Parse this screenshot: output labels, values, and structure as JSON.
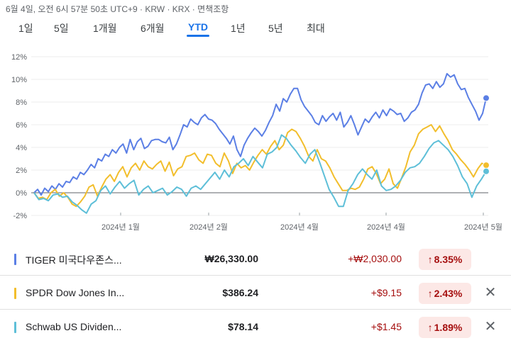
{
  "header": {
    "timestamp": "6월 4일, 오전 6시 57분 50초 UTC+9 · KRW · KRX · 면책조항"
  },
  "tabs": [
    {
      "label": "1일"
    },
    {
      "label": "5일"
    },
    {
      "label": "1개월"
    },
    {
      "label": "6개월"
    },
    {
      "label": "YTD",
      "active": true
    },
    {
      "label": "1년"
    },
    {
      "label": "5년"
    },
    {
      "label": "최대"
    }
  ],
  "colors": {
    "blue": "#5b7fe5",
    "yellow": "#f2be2c",
    "cyan": "#5ebfd8",
    "positive": "#a50e0e",
    "badge_bg": "#fce8e6"
  },
  "chart_data": {
    "type": "line",
    "y_unit": "%",
    "ylim": [
      -2,
      12
    ],
    "y_ticks": [
      "12%",
      "10%",
      "8%",
      "6%",
      "4%",
      "2%",
      "0%",
      "-2%"
    ],
    "x_ticks": [
      "2024년 1월",
      "2024년 2월",
      "2024년 4월",
      "2024년 4월",
      "2024년 5월"
    ],
    "grid": true,
    "series": [
      {
        "name": "TIGER 미국다우존스...",
        "color": "#5b7fe5",
        "values": [
          0.0,
          0.3,
          -0.2,
          0.4,
          0.1,
          0.6,
          0.3,
          0.8,
          0.5,
          1.0,
          0.9,
          1.4,
          1.2,
          1.8,
          1.6,
          2.0,
          2.5,
          2.2,
          3.0,
          2.8,
          3.4,
          3.2,
          3.8,
          3.5,
          4.0,
          4.3,
          3.5,
          4.7,
          3.8,
          4.5,
          4.8,
          3.9,
          4.1,
          4.6,
          4.7,
          4.7,
          4.5,
          4.4,
          4.9,
          3.8,
          4.3,
          5.1,
          6.0,
          5.8,
          6.5,
          6.2,
          6.0,
          6.6,
          6.9,
          6.5,
          6.4,
          6.1,
          5.6,
          5.2,
          4.8,
          4.3,
          5.0,
          3.8,
          3.2,
          4.2,
          4.8,
          5.3,
          5.7,
          5.4,
          5.0,
          5.5,
          6.2,
          6.8,
          7.8,
          7.2,
          8.3,
          8.0,
          8.7,
          9.2,
          9.2,
          8.2,
          7.6,
          7.2,
          6.8,
          6.2,
          6.0,
          6.8,
          6.3,
          6.7,
          7.0,
          6.4,
          7.1,
          5.8,
          6.2,
          6.8,
          6.0,
          5.1,
          5.8,
          6.5,
          6.2,
          6.7,
          7.1,
          6.6,
          7.3,
          6.8,
          7.4,
          7.2,
          6.9,
          7.0,
          6.3,
          6.6,
          7.1,
          7.3,
          7.8,
          8.8,
          9.5,
          9.6,
          9.2,
          9.8,
          9.3,
          9.6,
          10.5,
          10.2,
          10.4,
          9.6,
          9.1,
          9.2,
          8.4,
          7.8,
          7.2,
          6.4,
          7.0,
          8.35
        ]
      },
      {
        "name": "SPDR Dow Jones In...",
        "color": "#f2be2c",
        "values": [
          0.0,
          -0.5,
          -0.4,
          -0.6,
          0.0,
          0.3,
          -0.3,
          0.0,
          -0.4,
          -1.0,
          -1.2,
          -0.8,
          -0.3,
          0.5,
          0.7,
          -0.3,
          0.5,
          1.2,
          1.6,
          1.0,
          1.8,
          2.3,
          1.4,
          2.2,
          2.6,
          2.0,
          2.8,
          2.3,
          2.1,
          2.5,
          2.8,
          1.9,
          2.7,
          1.5,
          2.1,
          2.3,
          3.2,
          3.3,
          3.5,
          2.9,
          2.6,
          3.4,
          3.3,
          2.6,
          2.3,
          3.5,
          2.8,
          1.7,
          2.6,
          2.2,
          2.4,
          2.0,
          2.7,
          3.3,
          3.8,
          3.4,
          4.1,
          4.6,
          3.8,
          4.2,
          5.3,
          5.6,
          5.4,
          4.8,
          4.1,
          3.2,
          2.8,
          3.8,
          3.0,
          2.8,
          2.2,
          1.4,
          0.8,
          0.2,
          0.2,
          0.4,
          0.3,
          0.5,
          1.2,
          2.1,
          2.3,
          1.7,
          0.8,
          1.2,
          2.1,
          0.8,
          0.4,
          1.3,
          2.3,
          3.6,
          4.2,
          5.2,
          5.6,
          5.8,
          6.0,
          5.4,
          5.9,
          5.2,
          4.6,
          3.8,
          3.4,
          2.9,
          2.5,
          2.0,
          1.4,
          2.1,
          2.6,
          2.43
        ]
      },
      {
        "name": "Schwab US Dividen...",
        "color": "#5ebfd8",
        "values": [
          0.0,
          -0.6,
          -0.5,
          -0.7,
          -0.2,
          -0.1,
          -0.4,
          -0.3,
          -0.8,
          -1.1,
          -1.5,
          -1.8,
          -1.0,
          -0.7,
          0.2,
          0.6,
          -0.1,
          0.5,
          1.0,
          0.4,
          0.8,
          1.1,
          -0.2,
          0.3,
          0.6,
          0.0,
          0.2,
          0.4,
          -0.2,
          0.1,
          0.5,
          0.3,
          -0.3,
          0.4,
          0.6,
          0.3,
          0.8,
          1.3,
          1.8,
          1.2,
          2.0,
          1.4,
          2.3,
          2.6,
          3.0,
          2.4,
          3.2,
          2.7,
          2.2,
          3.4,
          3.6,
          4.0,
          5.1,
          4.8,
          4.2,
          3.7,
          3.1,
          2.6,
          3.4,
          3.8,
          2.7,
          1.5,
          0.3,
          -0.4,
          -1.2,
          -1.2,
          0.2,
          0.8,
          1.6,
          2.1,
          1.6,
          1.2,
          2.0,
          0.6,
          0.2,
          0.3,
          0.6,
          1.1,
          1.8,
          2.2,
          2.3,
          2.6,
          3.2,
          3.9,
          4.4,
          4.6,
          4.2,
          3.8,
          3.2,
          2.4,
          1.4,
          0.8,
          -0.4,
          0.6,
          1.2,
          1.89
        ]
      }
    ]
  },
  "holdings": [
    {
      "name": "TIGER 미국다우존스...",
      "price": "₩26,330.00",
      "change": "+₩2,030.00",
      "pct": "8.35%",
      "arrow": "↑",
      "color": "#5b7fe5",
      "removable": false
    },
    {
      "name": "SPDR Dow Jones In...",
      "price": "$386.24",
      "change": "+$9.15",
      "pct": "2.43%",
      "arrow": "↑",
      "color": "#f2be2c",
      "removable": true,
      "close": "✕"
    },
    {
      "name": "Schwab US Dividen...",
      "price": "$78.14",
      "change": "+$1.45",
      "pct": "1.89%",
      "arrow": "↑",
      "color": "#5ebfd8",
      "removable": true,
      "close": "✕"
    }
  ]
}
